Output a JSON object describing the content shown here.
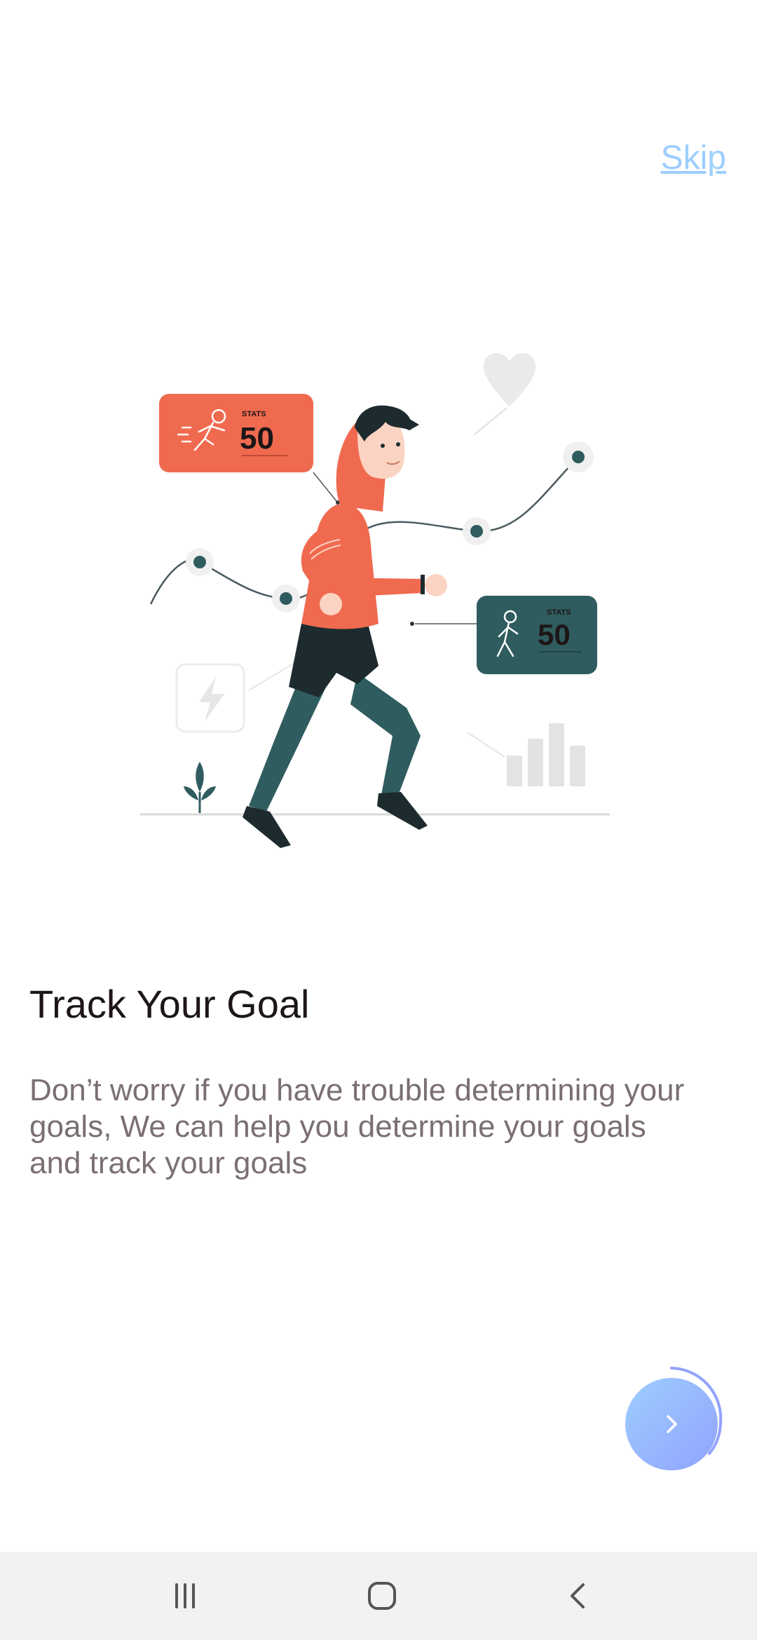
{
  "header": {
    "skip_label": "Skip"
  },
  "illustration": {
    "stat_card_1": {
      "label": "STATS",
      "value": "50"
    },
    "stat_card_2": {
      "label": "STATS",
      "value": "50"
    }
  },
  "content": {
    "title": "Track Your Goal",
    "description": "Don’t worry if you have trouble determining your goals, We can help you determine your goals and track your goals"
  },
  "colors": {
    "accent_start": "#9DCEFF",
    "accent_end": "#92A3FD",
    "illustration_red": "#F06A50",
    "illustration_teal": "#2F5C5F"
  },
  "icons": {
    "next": "chevron-right-icon",
    "recent_apps": "recent-apps-icon",
    "home": "home-icon",
    "back": "back-icon"
  }
}
